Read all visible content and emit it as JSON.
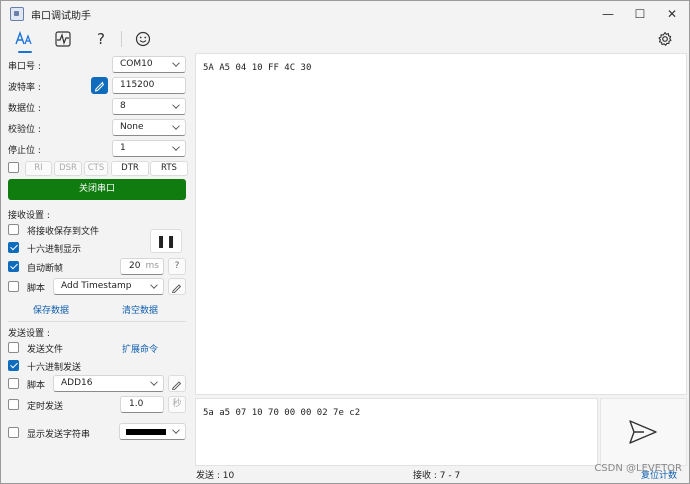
{
  "titlebar": {
    "title": "串口调试助手",
    "minimize": "—",
    "maximize": "☐",
    "close": "✕"
  },
  "toolbar": {
    "text_icon": "text-mode-icon",
    "wave_icon": "waveform-icon",
    "help": "?",
    "emoji_icon": "smiley-icon",
    "settings_icon": "gear-icon"
  },
  "serial": {
    "port_label": "串口号 :",
    "port_value": "COM10",
    "baud_label": "波特率 :",
    "baud_value": "115200",
    "databits_label": "数据位 :",
    "databits_value": "8",
    "parity_label": "校验位 :",
    "parity_value": "None",
    "stopbits_label": "停止位 :",
    "stopbits_value": "1",
    "pins": [
      "RI",
      "DSR",
      "CTS",
      "DTR",
      "RTS"
    ],
    "open_button": "关闭串口"
  },
  "receive": {
    "section_title": "接收设置 :",
    "save_to_file": "将接收保存到文件",
    "hex_display": "十六进制显示",
    "auto_frame": "自动断帧",
    "frame_ms_value": "20",
    "frame_ms_unit": "ms",
    "frame_help": "?",
    "script_label": "脚本",
    "script_value": "Add Timestamp",
    "save_data": "保存数据",
    "clear_data": "清空数据",
    "pause_symbol": "❚❚"
  },
  "send": {
    "section_title": "发送设置 :",
    "send_file": "发送文件",
    "extend_cmd": "扩展命令",
    "hex_send": "十六进制发送",
    "script_label": "脚本",
    "script_value": "ADD16",
    "timed_send": "定时发送",
    "timed_value": "1.0",
    "timed_unit": "秒",
    "show_send_string": "显示发送字符串",
    "color_value": "#000000"
  },
  "panes": {
    "received_text": "5A A5 04 10 FF 4C 30",
    "send_text": "5a a5 07 10 70 00 00 02 7e c2"
  },
  "status": {
    "sent": "发送 : 10",
    "received": "接收 : 7 - 7",
    "reset": "复位计数"
  },
  "watermark": "CSDN @LEVETOR",
  "colors": {
    "accent": "#0f6cbd",
    "open_button": "#107c10"
  }
}
